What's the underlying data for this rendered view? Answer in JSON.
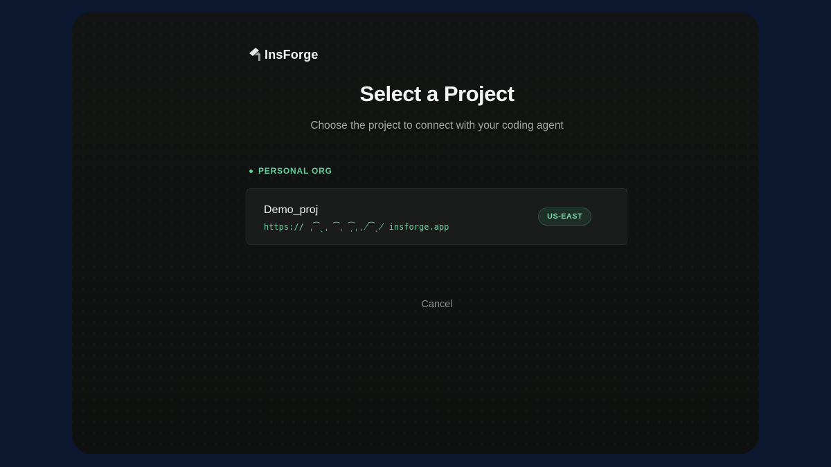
{
  "brand": {
    "name": "InsForge",
    "logo_icon": "insforge-logo-icon"
  },
  "header": {
    "title": "Select a Project",
    "subtitle": "Choose the project to connect with your coding agent"
  },
  "organizations": [
    {
      "label": "PERSONAL ORG",
      "projects": [
        {
          "name": "Demo_proj",
          "url": "https:// ˌ͡ˎˌ ͡ˌ ̣͡ˌˌ̸͡ˎ̸ insforge.app",
          "region": "US-EAST"
        }
      ]
    }
  ],
  "actions": {
    "cancel_label": "Cancel"
  },
  "colors": {
    "background": "#0c1730",
    "panel": "#111212",
    "accent": "#5fcf9b",
    "card": "#1a1b1b"
  }
}
